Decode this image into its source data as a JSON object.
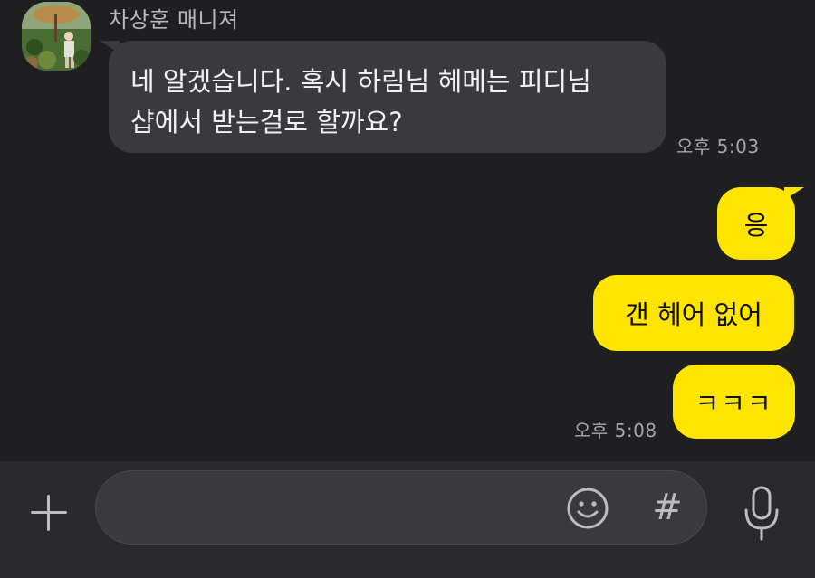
{
  "chat": {
    "incoming": {
      "sender": "차상훈 매니져",
      "text": "네 알겠습니다. 혹시 하림님 헤메는 피디님\n샵에서 받는걸로 할까요?",
      "time": "오후 5:03"
    },
    "outgoing": {
      "messages": [
        "응",
        "갠 헤어 없어",
        "ㅋㅋㅋ"
      ],
      "time": "오후 5:08"
    }
  },
  "input_bar": {
    "placeholder": "",
    "value": "",
    "hash_label": "#",
    "icons": {
      "attach": "plus-icon",
      "emoji": "smiley-icon",
      "hash": "hash-icon",
      "mic": "microphone-icon"
    }
  },
  "colors": {
    "background": "#1f1f21",
    "incoming_bubble": "#3a3a3d",
    "outgoing_bubble": "#fee500",
    "input_bar": "#2a2a2c"
  }
}
